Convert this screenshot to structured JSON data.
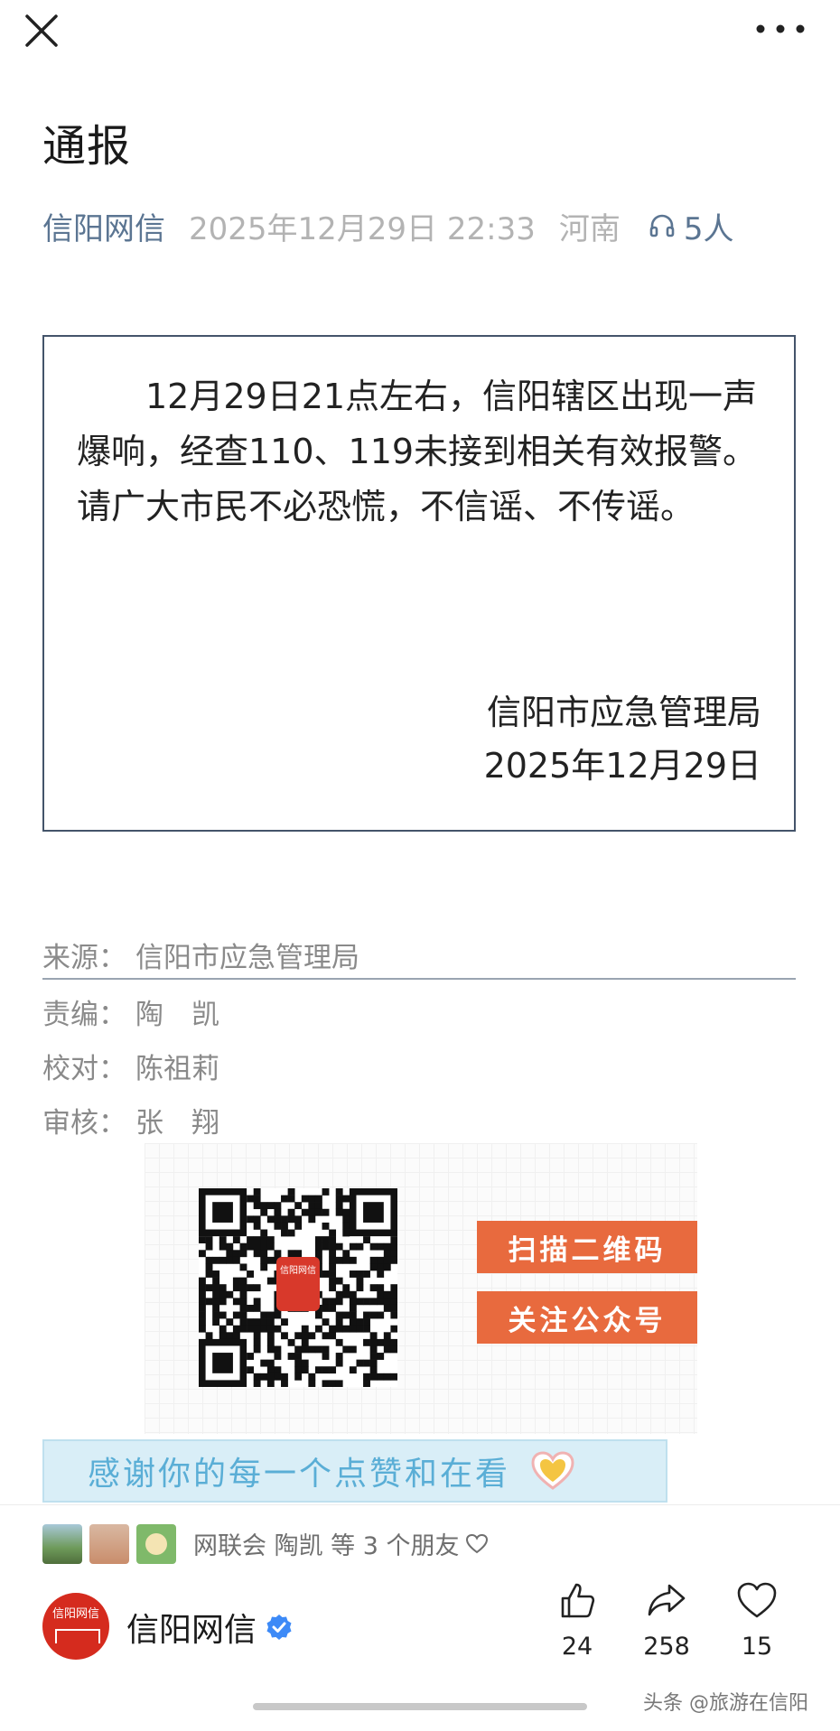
{
  "top_bar": {
    "close_icon": "close-icon",
    "more_icon": "more-dots-icon"
  },
  "article": {
    "title": "通报",
    "author": "信阳网信",
    "datetime": "2025年12月29日 22:33",
    "region": "河南",
    "listeners": "5人"
  },
  "notice": {
    "body": "12月29日21点左右，信阳辖区出现一声爆响，经查110、119未接到相关有效报警。请广大市民不必恐慌，不信谣、不传谣。",
    "signer": "信阳市应急管理局",
    "date": "2025年12月29日"
  },
  "credits": {
    "source_label": "来源：",
    "source_value": "信阳市应急管理局",
    "editor_label": "责编：",
    "editor_value": "陶　凯",
    "proof_label": "校对：",
    "proof_value": "陈祖莉",
    "review_label": "审核：",
    "review_value": "张　翔"
  },
  "qr": {
    "center_logo_text": "信阳网信",
    "scan_label": "扫描二维码",
    "follow_label": "关注公众号"
  },
  "thanks_banner": {
    "text": "感谢你的每一个点赞和在看"
  },
  "friends": {
    "text": "网联会  陶凯  等 3 个朋友"
  },
  "account": {
    "name": "信阳网信",
    "avatar_text": "信阳网信"
  },
  "actions": {
    "likes": "24",
    "shares": "258",
    "favorites": "15"
  },
  "watermark": "头条 @旅游在信阳",
  "colors": {
    "accent_orange": "#e86a3e",
    "author_blue": "#5b7592",
    "verified_blue": "#3d8af7",
    "banner_bg": "#d9eef7"
  }
}
